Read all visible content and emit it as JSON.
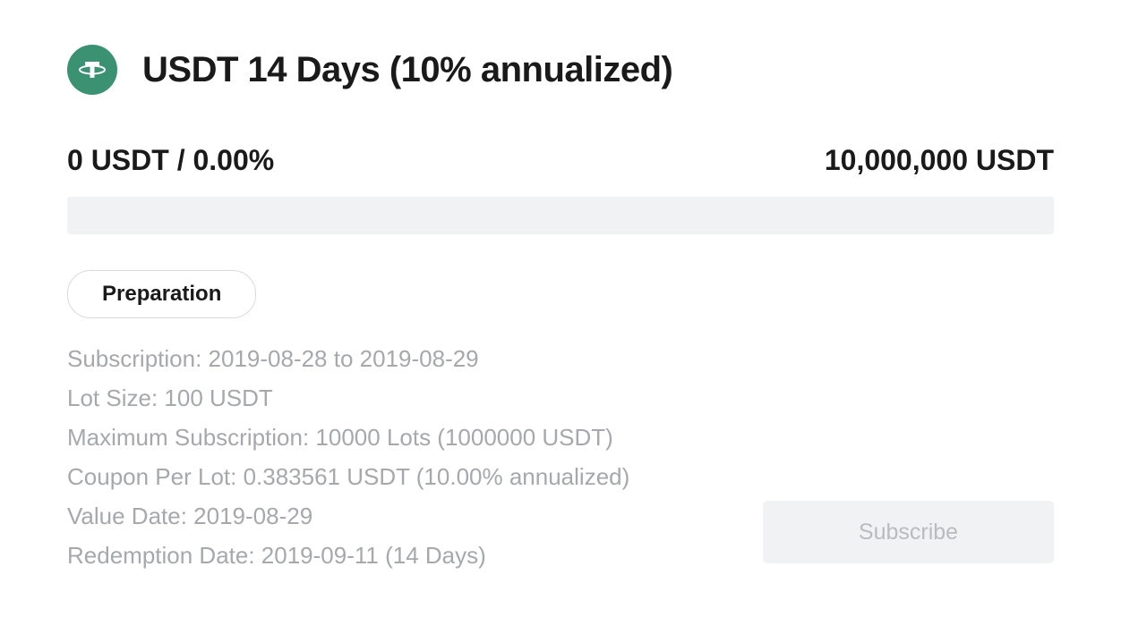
{
  "product": {
    "title": "USDT 14 Days (10% annualized)",
    "icon_name": "tether",
    "icon_color": "#3a9273"
  },
  "progress": {
    "current_text": "0 USDT / 0.00%",
    "total_text": "10,000,000 USDT",
    "percent": 0
  },
  "status": {
    "label": "Preparation"
  },
  "details": {
    "subscription": "Subscription: 2019-08-28 to 2019-08-29",
    "lot_size": "Lot Size: 100 USDT",
    "max_subscription": "Maximum Subscription: 10000 Lots (1000000 USDT)",
    "coupon": "Coupon Per Lot: 0.383561 USDT (10.00% annualized)",
    "value_date": "Value Date: 2019-08-29",
    "redemption_date": "Redemption Date: 2019-09-11 (14 Days)"
  },
  "actions": {
    "subscribe_label": "Subscribe"
  }
}
